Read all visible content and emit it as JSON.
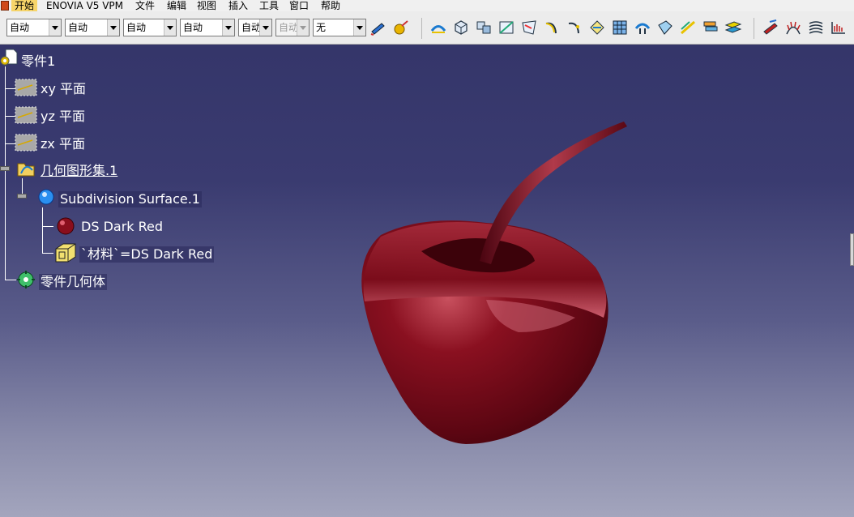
{
  "menu": {
    "items": [
      {
        "label": "开始",
        "active": true
      },
      {
        "label": "ENOVIA V5 VPM"
      },
      {
        "label": "文件"
      },
      {
        "label": "编辑"
      },
      {
        "label": "视图"
      },
      {
        "label": "插入"
      },
      {
        "label": "工具"
      },
      {
        "label": "窗口"
      },
      {
        "label": "帮助"
      }
    ]
  },
  "toolbar": {
    "combo1": "自动",
    "combo2": "自动",
    "combo3": "自动",
    "combo4": "自动",
    "combo5": "自动",
    "combo6": "自动",
    "combo7": "无"
  },
  "tree": {
    "root": "零件1",
    "xy": "xy 平面",
    "yz": "yz 平面",
    "zx": "zx 平面",
    "geoset": "几何图形集.1",
    "subdiv": "Subdivision Surface.1",
    "color": "DS Dark Red",
    "material": "`材料`=DS Dark Red",
    "body": "零件几何体"
  },
  "colors": {
    "background_top": "#333468",
    "background_bottom": "#a3a5bd",
    "model": "#6b0a18",
    "tree_text": "#ffffff"
  }
}
